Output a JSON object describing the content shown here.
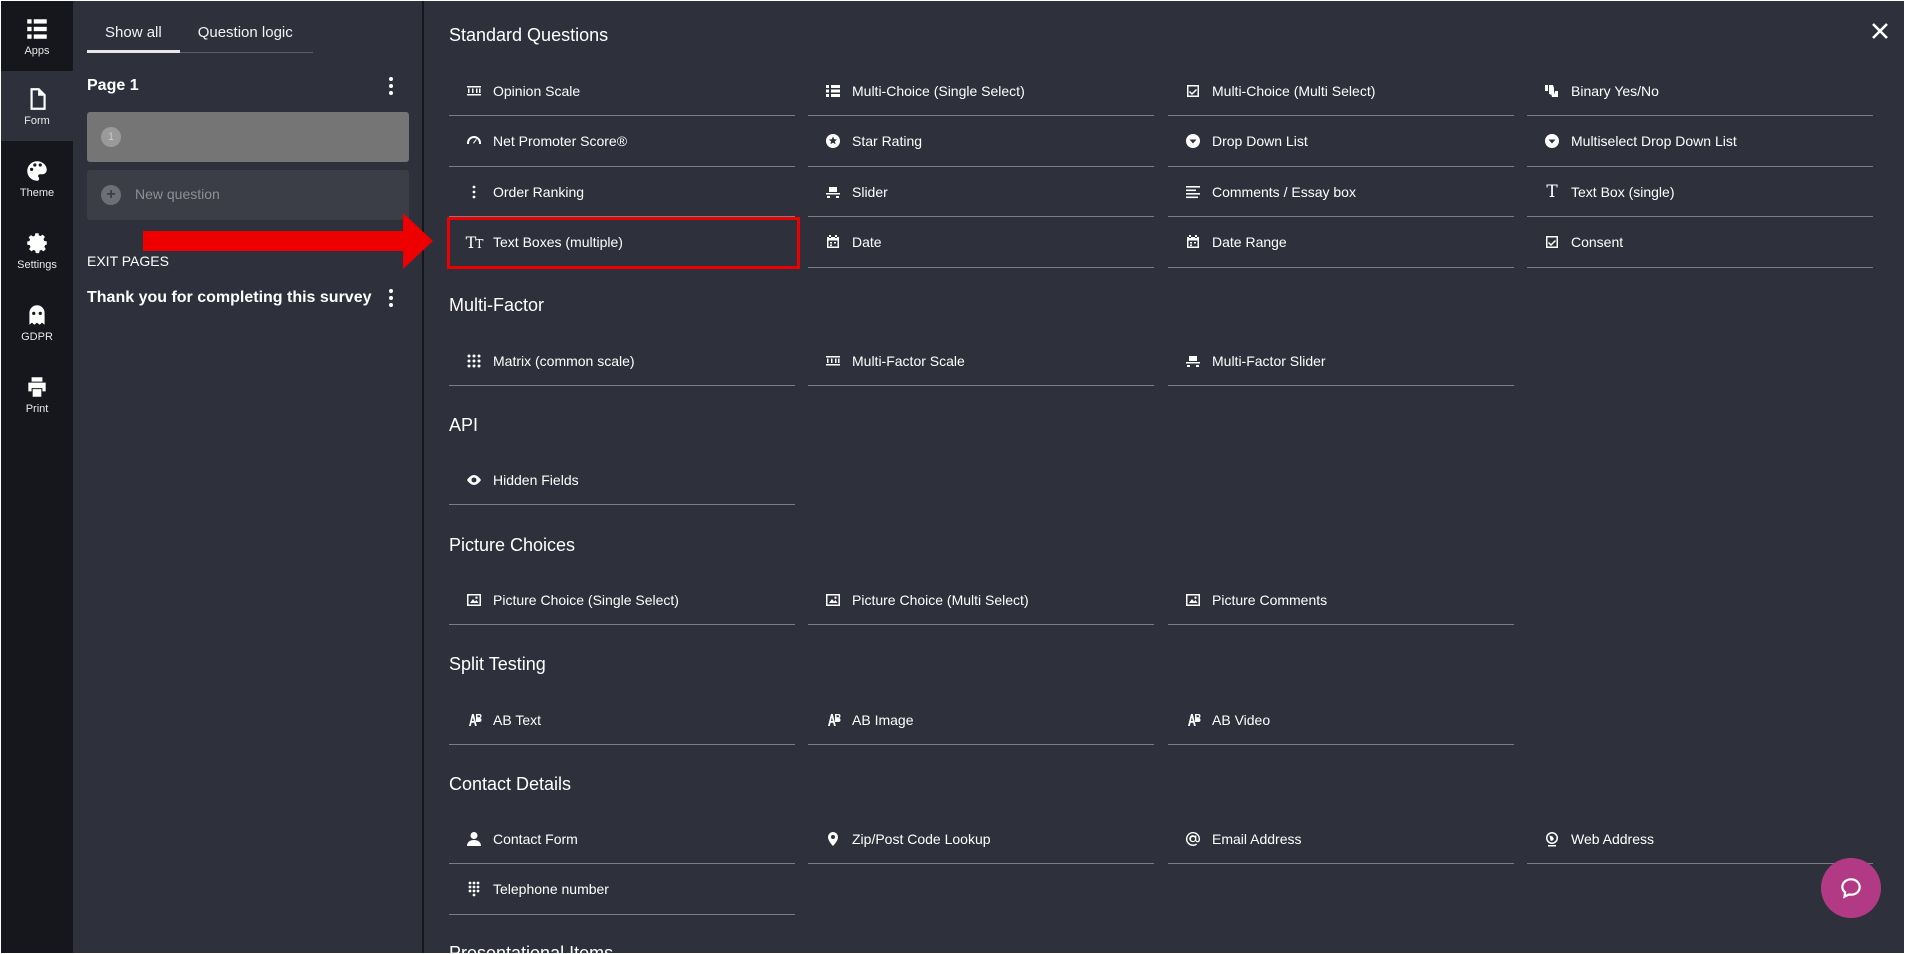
{
  "rail": [
    {
      "label": "Apps",
      "icon": "apps-icon"
    },
    {
      "label": "Form",
      "icon": "form-icon",
      "active": true
    },
    {
      "label": "Theme",
      "icon": "theme-icon"
    },
    {
      "label": "Settings",
      "icon": "settings-icon"
    },
    {
      "label": "GDPR",
      "icon": "gdpr-icon"
    },
    {
      "label": "Print",
      "icon": "print-icon"
    }
  ],
  "panel": {
    "tabs": [
      "Show all",
      "Question logic"
    ],
    "page_title": "Page 1",
    "question_number": "1",
    "new_question": "New question",
    "exit_pages_label": "EXIT PAGES",
    "exit_page_title": "Thank you for completing this survey"
  },
  "sections": [
    {
      "title": "Standard Questions",
      "items": [
        {
          "label": "Opinion Scale",
          "icon": "opinion-scale-icon"
        },
        {
          "label": "Multi-Choice (Single Select)",
          "icon": "list-icon"
        },
        {
          "label": "Multi-Choice (Multi Select)",
          "icon": "checkbox-icon"
        },
        {
          "label": "Binary Yes/No",
          "icon": "thumbs-icon"
        },
        {
          "label": "Net Promoter Score®",
          "icon": "gauge-icon"
        },
        {
          "label": "Star Rating",
          "icon": "star-icon"
        },
        {
          "label": "Drop Down List",
          "icon": "dropdown-icon"
        },
        {
          "label": "Multiselect Drop Down List",
          "icon": "dropdown-icon"
        },
        {
          "label": "Order Ranking",
          "icon": "drag-icon"
        },
        {
          "label": "Slider",
          "icon": "slider-icon"
        },
        {
          "label": "Comments / Essay box",
          "icon": "paragraph-icon"
        },
        {
          "label": "Text Box (single)",
          "icon": "text-icon"
        },
        {
          "label": "Text Boxes (multiple)",
          "icon": "text-multiple-icon"
        },
        {
          "label": "Date",
          "icon": "calendar-icon"
        },
        {
          "label": "Date Range",
          "icon": "calendar-icon"
        },
        {
          "label": "Consent",
          "icon": "checkbox-icon"
        }
      ]
    },
    {
      "title": "Multi-Factor",
      "items": [
        {
          "label": "Matrix (common scale)",
          "icon": "grid-icon"
        },
        {
          "label": "Multi-Factor Scale",
          "icon": "opinion-scale-icon"
        },
        {
          "label": "Multi-Factor Slider",
          "icon": "slider-icon"
        }
      ]
    },
    {
      "title": "API",
      "items": [
        {
          "label": "Hidden Fields",
          "icon": "eye-icon"
        }
      ]
    },
    {
      "title": "Picture Choices",
      "items": [
        {
          "label": "Picture Choice (Single Select)",
          "icon": "picture-icon"
        },
        {
          "label": "Picture Choice (Multi Select)",
          "icon": "picture-icon"
        },
        {
          "label": "Picture Comments",
          "icon": "picture-icon"
        }
      ]
    },
    {
      "title": "Split Testing",
      "items": [
        {
          "label": "AB Text",
          "icon": "ab-icon"
        },
        {
          "label": "AB Image",
          "icon": "ab-icon"
        },
        {
          "label": "AB Video",
          "icon": "ab-icon"
        }
      ]
    },
    {
      "title": "Contact Details",
      "items": [
        {
          "label": "Contact Form",
          "icon": "person-icon"
        },
        {
          "label": "Zip/Post Code Lookup",
          "icon": "pin-icon"
        },
        {
          "label": "Email Address",
          "icon": "at-icon"
        },
        {
          "label": "Web Address",
          "icon": "globe-icon"
        },
        {
          "label": "Telephone number",
          "icon": "dialpad-icon"
        }
      ]
    },
    {
      "title": "Presentational Items",
      "items": []
    }
  ],
  "colors": {
    "background": "#2e313b",
    "rail": "#15171c",
    "highlight": "#ee0000",
    "help": "#b23a85"
  }
}
